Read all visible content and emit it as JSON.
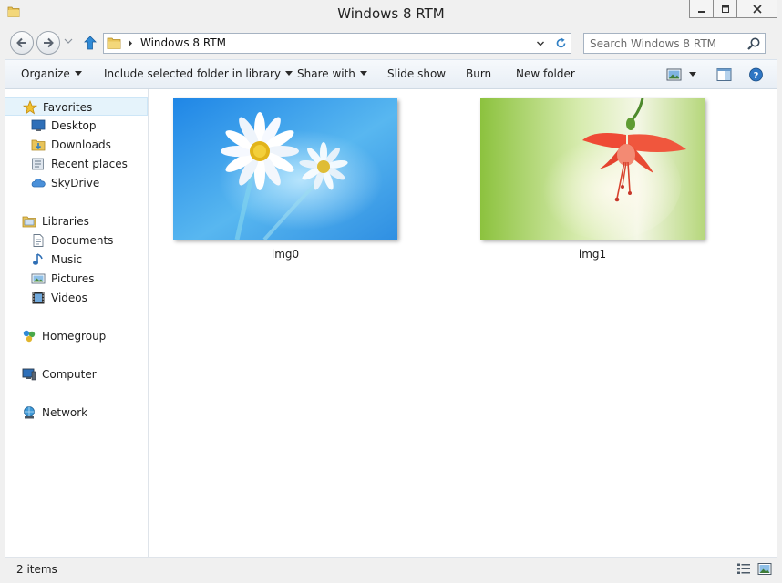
{
  "window": {
    "title": "Windows 8 RTM",
    "icons": {
      "app": "folder-icon",
      "minimize": "minimize-icon",
      "maximize": "maximize-icon",
      "close": "close-icon"
    }
  },
  "navigation": {
    "path": [
      "Windows 8 RTM"
    ],
    "search_placeholder": "Search Windows 8 RTM",
    "icons": {
      "back": "back-arrow-icon",
      "forward": "forward-arrow-icon",
      "recent": "chevron-down-icon",
      "up": "up-arrow-icon",
      "refresh": "refresh-icon",
      "search": "search-icon"
    }
  },
  "toolbar": {
    "organize": "Organize",
    "include_library": "Include selected folder in library",
    "share_with": "Share with",
    "slide_show": "Slide show",
    "burn": "Burn",
    "new_folder": "New folder",
    "icons": [
      "change-view-icon",
      "preview-pane-icon",
      "help-icon"
    ]
  },
  "sidebar": {
    "favorites": {
      "label": "Favorites",
      "icon": "star-icon",
      "items": [
        {
          "label": "Desktop",
          "icon": "desktop-icon"
        },
        {
          "label": "Downloads",
          "icon": "downloads-folder-icon"
        },
        {
          "label": "Recent places",
          "icon": "recent-places-icon"
        },
        {
          "label": "SkyDrive",
          "icon": "skydrive-icon"
        }
      ]
    },
    "libraries": {
      "label": "Libraries",
      "icon": "libraries-icon",
      "items": [
        {
          "label": "Documents",
          "icon": "documents-icon"
        },
        {
          "label": "Music",
          "icon": "music-icon"
        },
        {
          "label": "Pictures",
          "icon": "pictures-icon"
        },
        {
          "label": "Videos",
          "icon": "videos-icon"
        }
      ]
    },
    "homegroup": {
      "label": "Homegroup",
      "icon": "homegroup-icon"
    },
    "computer": {
      "label": "Computer",
      "icon": "computer-icon"
    },
    "network": {
      "label": "Network",
      "icon": "network-icon"
    }
  },
  "files": [
    {
      "name": "img0",
      "thumbnail": "daisy-on-blue-thumbnail"
    },
    {
      "name": "img1",
      "thumbnail": "red-fuchsia-on-green-thumbnail"
    }
  ],
  "status": {
    "item_count": "2 items",
    "icons": [
      "details-view-icon",
      "large-icons-view-icon"
    ]
  },
  "colors": {
    "accent": "#3c7fb1",
    "selection": "#e5f3fb",
    "command_bar": "#eaf0f6"
  }
}
